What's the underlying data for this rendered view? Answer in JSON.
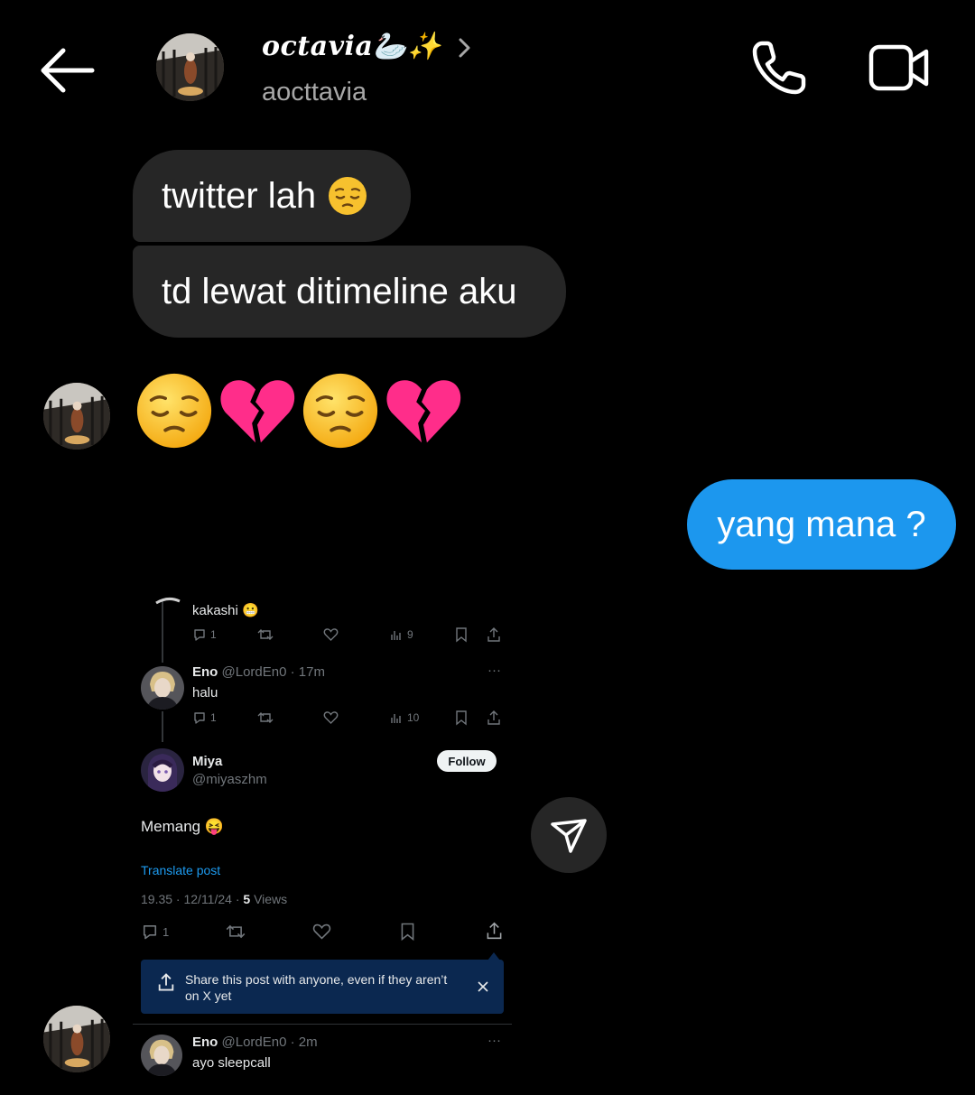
{
  "header": {
    "display_name": "octavia",
    "display_name_emojis": "🦢✨",
    "username": "aocttavia",
    "icons": [
      "back-arrow-icon",
      "chevron-right-icon",
      "phone-icon",
      "video-camera-icon"
    ]
  },
  "messages": {
    "received_1": {
      "text": "twitter lah",
      "emoji": "😔"
    },
    "received_2": {
      "text": "td lewat ditimeline aku"
    },
    "received_3": {
      "emojis": [
        "😔",
        "💔",
        "😔",
        "💔"
      ]
    },
    "sent_1": {
      "text": "yang mana ?"
    }
  },
  "shared_screenshot": {
    "reply_1": {
      "text": "kakashi",
      "emoji": "😬",
      "replies": "1",
      "views": "9"
    },
    "reply_2": {
      "name": "Eno",
      "handle": "@LordEn0",
      "time": "· 17m",
      "text": "halu",
      "replies": "1",
      "views": "10"
    },
    "main_post": {
      "name": "Miya",
      "handle": "@miyaszhm",
      "follow_label": "Follow",
      "text": "Memang",
      "emoji": "😝",
      "translate_label": "Translate post",
      "timestamp": "19.35 · 12/11/24 ·",
      "views_count": "5",
      "views_label": "Views",
      "replies": "1"
    },
    "toast": {
      "text": "Share this post with anyone, even if they aren’t on X yet"
    },
    "reply_3": {
      "name": "Eno",
      "handle": "@LordEn0",
      "time": "· 2m",
      "text": "ayo sleepcall"
    }
  },
  "colors": {
    "background": "#000000",
    "bubble_received": "#262626",
    "bubble_sent": "#1c97ee",
    "toast_bg": "#0b2850",
    "link_blue": "#1d9bf0"
  }
}
